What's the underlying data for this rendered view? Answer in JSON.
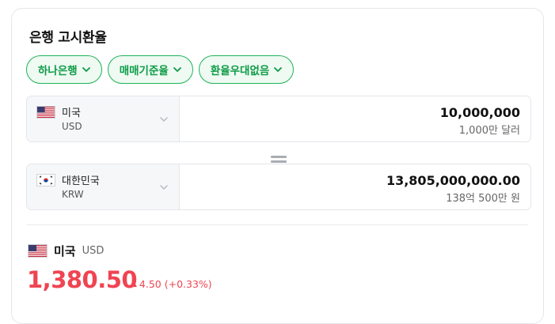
{
  "card": {
    "title": "은행 고시환율",
    "filters": [
      {
        "label": "하나은행"
      },
      {
        "label": "매매기준율"
      },
      {
        "label": "환율우대없음"
      }
    ]
  },
  "converter": {
    "from": {
      "country": "미국",
      "code": "USD",
      "flag": "us-flag-icon",
      "amount": "10,000,000",
      "amount_text": "1,000만 달러"
    },
    "to": {
      "country": "대한민국",
      "code": "KRW",
      "flag": "kr-flag-icon",
      "amount": "13,805,000,000.00",
      "amount_text": "138억 500만 원"
    }
  },
  "rate": {
    "country": "미국",
    "code": "USD",
    "value": "1,380.50",
    "change": "4.50 (+0.33%)",
    "direction": "up"
  },
  "colors": {
    "accent_green": "#1fb35a",
    "up_red": "#f04452"
  }
}
